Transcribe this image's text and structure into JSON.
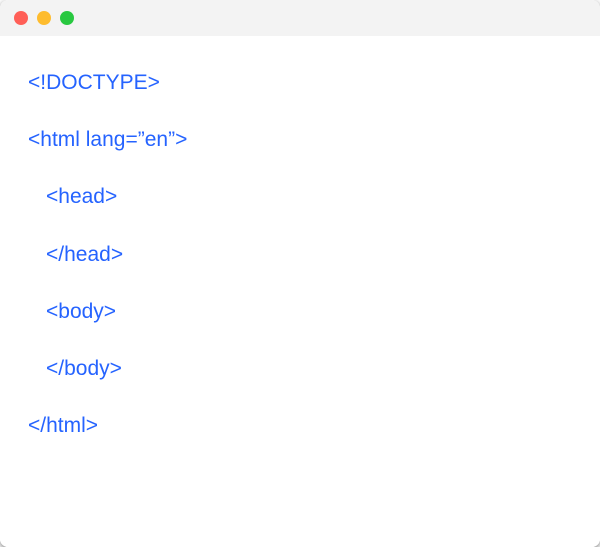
{
  "code": {
    "line1": "<!DOCTYPE>",
    "line2": "<html lang=”en”>",
    "line3": "<head>",
    "line4": "</head>",
    "line5": "<body>",
    "line6": "</body>",
    "line7": "</html>"
  }
}
